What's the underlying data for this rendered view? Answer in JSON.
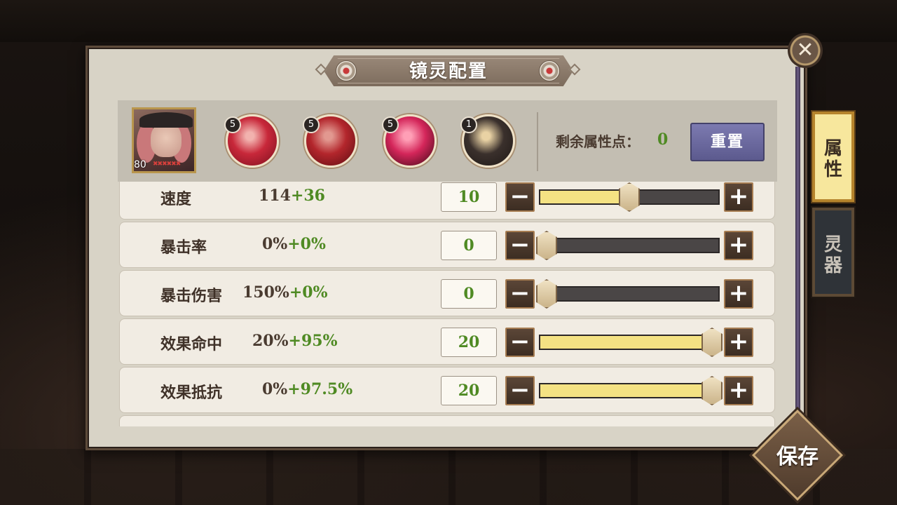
{
  "title": "镜灵配置",
  "portrait": {
    "level": "80",
    "stars": "✖✖✖✖✖✖"
  },
  "souls": [
    {
      "count": "5",
      "colors": [
        "#f2b2ae",
        "#c8283a",
        "#7a0f1e"
      ]
    },
    {
      "count": "5",
      "colors": [
        "#e29890",
        "#b3262c",
        "#5a0c12"
      ]
    },
    {
      "count": "5",
      "colors": [
        "#ff9fb6",
        "#d4265a",
        "#3a0714"
      ]
    },
    {
      "count": "1",
      "colors": [
        "#e9d2a4",
        "#3a302c",
        "#1f1916"
      ]
    }
  ],
  "remaining": {
    "label": "剩余属性点：",
    "value": "0"
  },
  "reset_label": "重置",
  "stats": [
    {
      "name": "速度",
      "base": "114",
      "bonus": "+36",
      "points": "10",
      "level": 0.5
    },
    {
      "name": "暴击率",
      "base": "0%",
      "bonus": "+0%",
      "points": "0",
      "level": 0
    },
    {
      "name": "暴击伤害",
      "base": "150%",
      "bonus": "+0%",
      "points": "0",
      "level": 0
    },
    {
      "name": "效果命中",
      "base": "20%",
      "bonus": "+95%",
      "points": "20",
      "level": 1
    },
    {
      "name": "效果抵抗",
      "base": "0%",
      "bonus": "+97.5%",
      "points": "20",
      "level": 1
    }
  ],
  "controls": {
    "minus": "−",
    "plus": "+"
  },
  "tabs": {
    "attributes": [
      "属",
      "性"
    ],
    "spirit_weapon": [
      "灵",
      "器"
    ]
  },
  "save_label": "保存",
  "close_glyph": "✕",
  "colors": {
    "bonus_green": "#4f8a23",
    "slider_fill": "#f4e283",
    "reset_purple": "#6a68a0"
  }
}
